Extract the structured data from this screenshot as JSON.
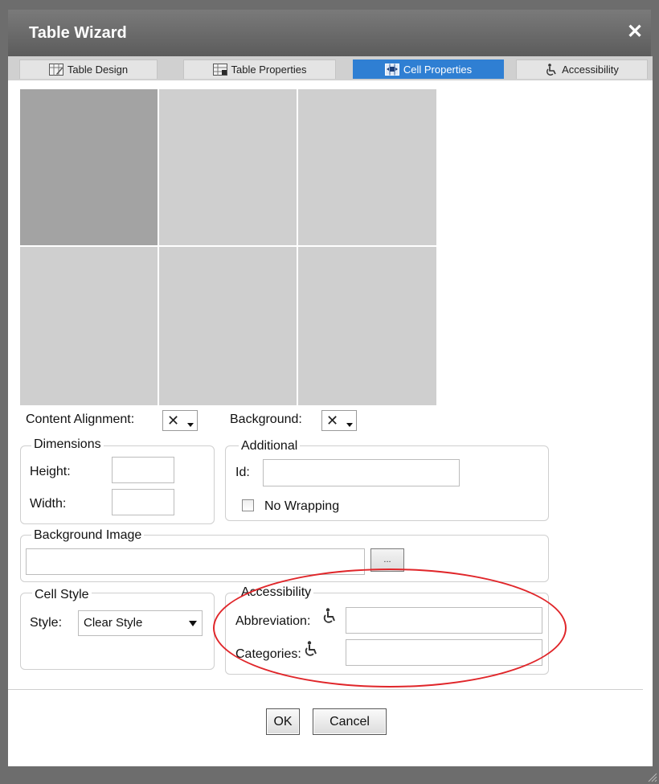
{
  "window": {
    "title": "Table Wizard",
    "close_glyph": "✕"
  },
  "tabs": [
    {
      "label": "Table Design",
      "icon": "table-design-icon",
      "active": false
    },
    {
      "label": "Table Properties",
      "icon": "table-properties-icon",
      "active": false
    },
    {
      "label": "Cell Properties",
      "icon": "cell-properties-icon",
      "active": true
    },
    {
      "label": "Accessibility",
      "icon": "accessibility-icon",
      "active": false
    }
  ],
  "preview": {
    "rows": 2,
    "cols": 3,
    "selected_cell": [
      0,
      0
    ]
  },
  "alignment": {
    "label": "Content Alignment:",
    "value_glyph": "✕"
  },
  "background": {
    "label": "Background:",
    "value_glyph": "✕"
  },
  "dimensions": {
    "legend": "Dimensions",
    "height_label": "Height:",
    "width_label": "Width:",
    "height_value": "",
    "width_value": ""
  },
  "additional": {
    "legend": "Additional",
    "id_label": "Id:",
    "id_value": "",
    "nowrap_label": "No Wrapping",
    "nowrap_checked": false
  },
  "background_image": {
    "legend": "Background Image",
    "value": "",
    "browse_label": "..."
  },
  "cell_style": {
    "legend": "Cell Style",
    "style_label": "Style:",
    "style_value": "Clear Style"
  },
  "accessibility": {
    "legend": "Accessibility",
    "abbreviation_label": "Abbreviation:",
    "categories_label": "Categories:",
    "abbreviation_value": "",
    "categories_value": ""
  },
  "buttons": {
    "ok": "OK",
    "cancel": "Cancel"
  },
  "colors": {
    "tab_active": "#2f7fd3",
    "highlight_ellipse": "#e0262a",
    "selected_cell": "#a3a3a3",
    "cell": "#cfcfcf"
  }
}
